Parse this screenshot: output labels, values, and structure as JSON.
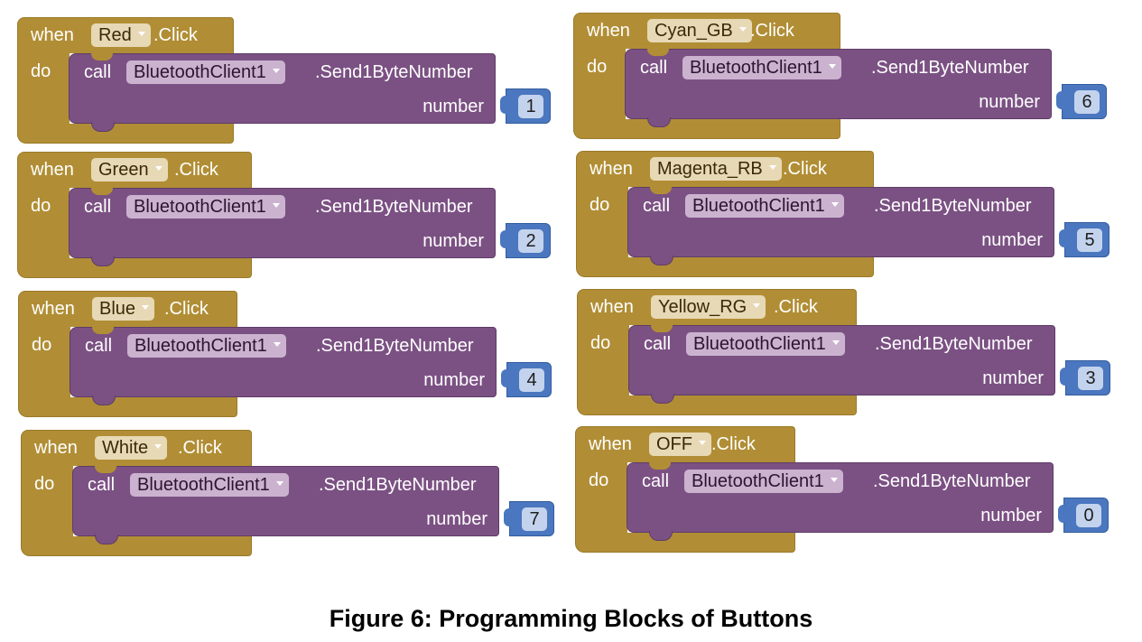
{
  "keywords": {
    "when": "when",
    "do": "do",
    "call": "call",
    "click": ".Click",
    "method": ".Send1ByteNumber",
    "arg": "number"
  },
  "blocks": [
    {
      "component": "Red",
      "device": "BluetoothClient1",
      "value": "1"
    },
    {
      "component": "Green",
      "device": "BluetoothClient1",
      "value": "2"
    },
    {
      "component": "Blue",
      "device": "BluetoothClient1",
      "value": "4"
    },
    {
      "component": "White",
      "device": "BluetoothClient1",
      "value": "7"
    },
    {
      "component": "Cyan_GB",
      "device": "BluetoothClient1",
      "value": "6"
    },
    {
      "component": "Magenta_RB",
      "device": "BluetoothClient1",
      "value": "5"
    },
    {
      "component": "Yellow_RG",
      "device": "BluetoothClient1",
      "value": "3"
    },
    {
      "component": "OFF",
      "device": "BluetoothClient1",
      "value": "0"
    }
  ],
  "caption": "Figure 6: Programming Blocks of Buttons",
  "colors": {
    "event": "#b18e35",
    "procedure": "#7b5183",
    "number": "#4a77bf"
  }
}
